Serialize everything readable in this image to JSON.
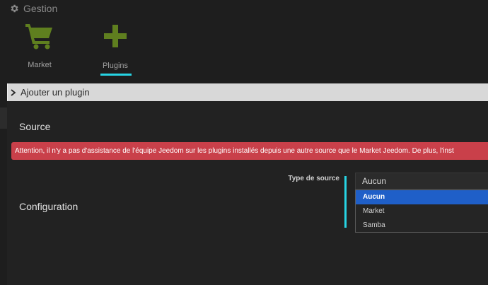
{
  "header": {
    "section_label": "Gestion",
    "tiles": [
      {
        "label": "Market",
        "icon": "shopping-cart-icon",
        "color": "#5f7f1f"
      },
      {
        "label": "Plugins",
        "icon": "plus-icon",
        "color": "#5f7f1f",
        "active": true
      }
    ],
    "active_color": "#27d4e4"
  },
  "panel": {
    "title": "Ajouter un plugin",
    "source_title": "Source",
    "alert_text": "Attention, il n'y a pas d'assistance de l'équipe Jeedom sur les plugins installés depuis une autre source que le Market Jeedom. De plus, l'inst",
    "alert_color": "#c9404a",
    "config_title": "Configuration",
    "source_type": {
      "label": "Type de source",
      "value": "Aucun",
      "options": [
        "Aucun",
        "Market",
        "Samba"
      ],
      "highlighted": "Aucun"
    }
  }
}
